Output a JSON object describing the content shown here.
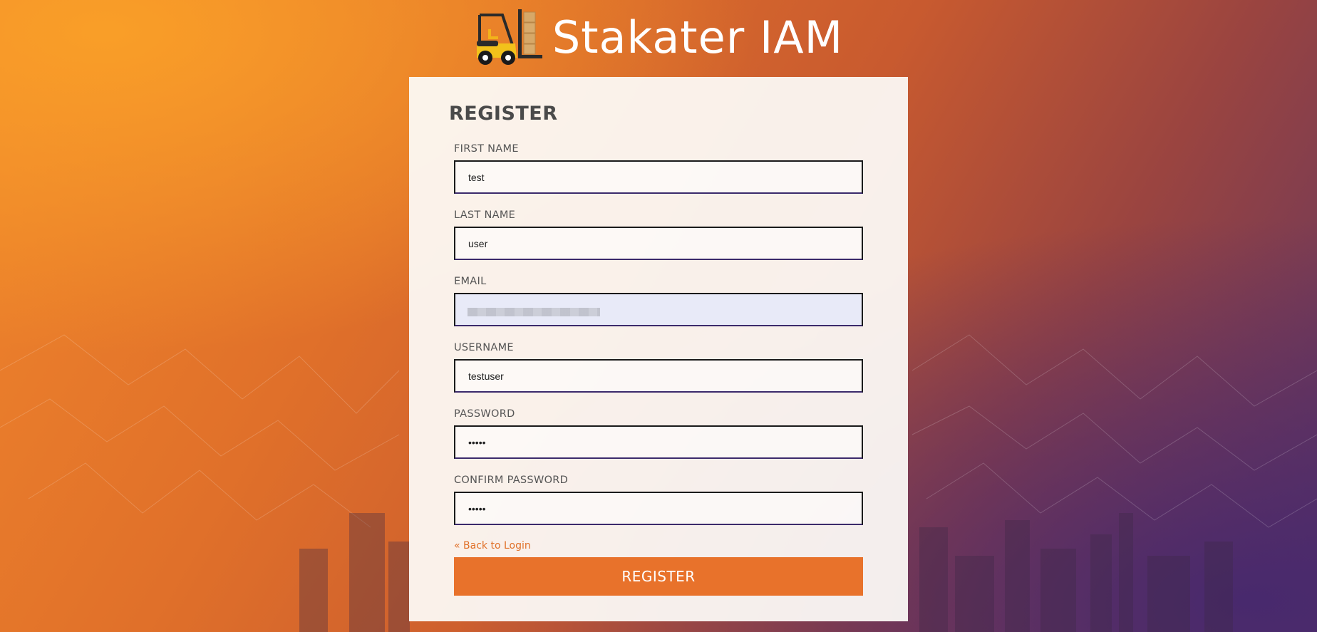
{
  "app": {
    "title": "Stakater IAM",
    "logo_icon": "forklift-icon"
  },
  "form": {
    "title": "REGISTER",
    "fields": {
      "first_name": {
        "label": "FIRST NAME",
        "value": "test"
      },
      "last_name": {
        "label": "LAST NAME",
        "value": "user"
      },
      "email": {
        "label": "EMAIL",
        "value": ""
      },
      "username": {
        "label": "USERNAME",
        "value": "testuser"
      },
      "password": {
        "label": "PASSWORD",
        "value": "•••••"
      },
      "confirm_password": {
        "label": "CONFIRM PASSWORD",
        "value": "•••••"
      }
    },
    "back_link": "« Back to Login",
    "submit_label": "REGISTER"
  },
  "colors": {
    "accent": "#e8722b",
    "title_text": "#4a4a4a",
    "label_text": "#555555",
    "input_border": "#1a1a1a",
    "email_autofill_bg": "#e8eaf8"
  }
}
